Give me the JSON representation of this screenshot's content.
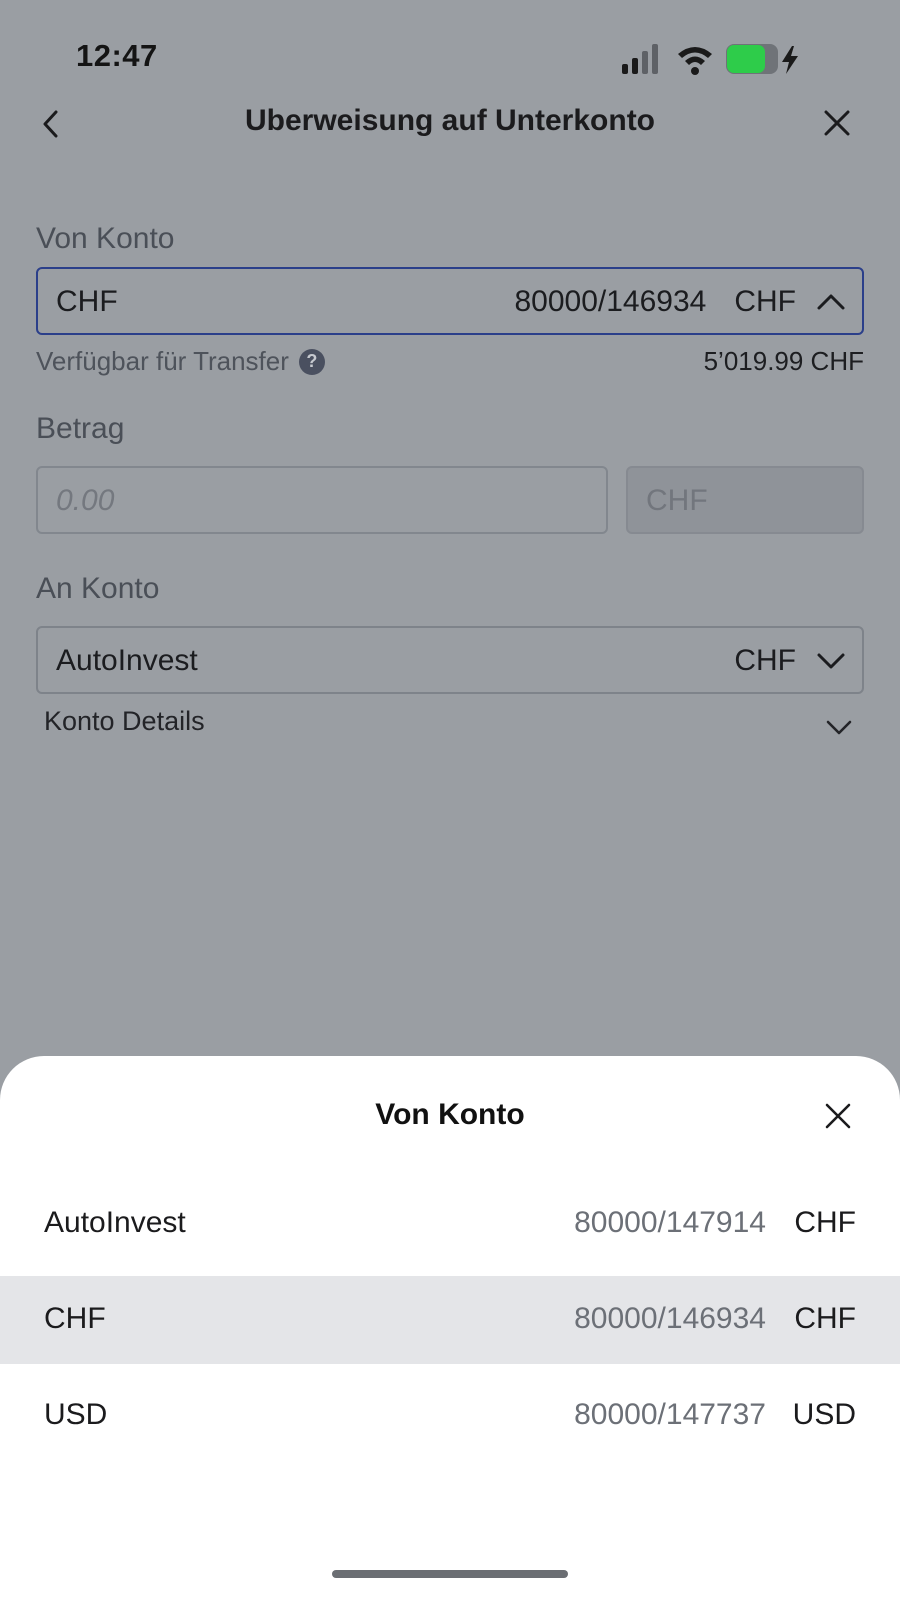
{
  "status_bar": {
    "time": "12:47",
    "battery_color": "#2ecc4a"
  },
  "header": {
    "title": "Uberweisung auf Unterkonto",
    "back_icon": "chevron-left-icon",
    "close_icon": "close-icon"
  },
  "from_account": {
    "label": "Von Konto",
    "selected_name": "CHF",
    "selected_number": "80000/146934",
    "selected_currency": "CHF",
    "available_label": "Verfügbar für Transfer",
    "available_value": "5’019.99 CHF"
  },
  "amount": {
    "label": "Betrag",
    "placeholder": "0.00",
    "currency": "CHF"
  },
  "to_account": {
    "label": "An Konto",
    "selected_name": "AutoInvest",
    "selected_currency": "CHF",
    "details_label": "Konto Details"
  },
  "sheet": {
    "title": "Von Konto",
    "options": [
      {
        "name": "AutoInvest",
        "number": "80000/147914",
        "currency": "CHF",
        "selected": false
      },
      {
        "name": "CHF",
        "number": "80000/146934",
        "currency": "CHF",
        "selected": true
      },
      {
        "name": "USD",
        "number": "80000/147737",
        "currency": "USD",
        "selected": false
      }
    ]
  },
  "colors": {
    "overlay_background": "#9a9ea3",
    "active_border": "#2b3f8a",
    "selected_row": "#e4e5e8"
  }
}
